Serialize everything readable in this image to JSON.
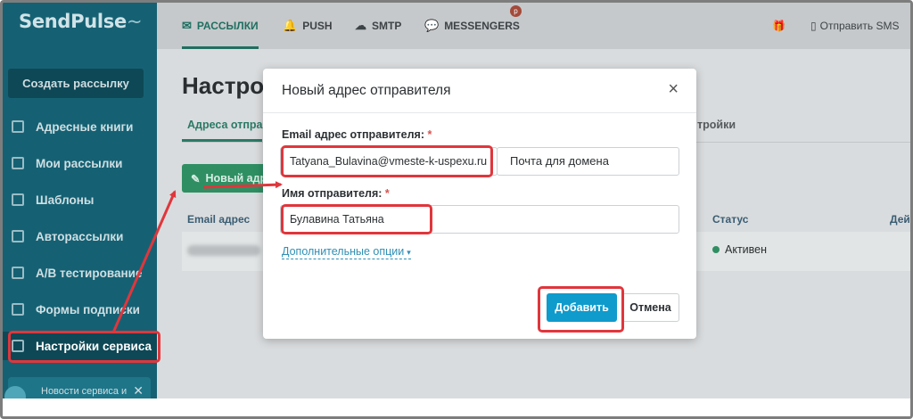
{
  "sidebar": {
    "logo_text": "SendPulse",
    "logo_pulse": "~",
    "create_label": "Создать рассылку",
    "items": [
      {
        "label": "Адресные книги",
        "icon": "address-book-icon"
      },
      {
        "label": "Мои рассылки",
        "icon": "campaigns-icon"
      },
      {
        "label": "Шаблоны",
        "icon": "templates-icon"
      },
      {
        "label": "Авторассылки",
        "icon": "automation-icon"
      },
      {
        "label": "A/B тестирование",
        "icon": "ab-test-icon"
      },
      {
        "label": "Формы подписки",
        "icon": "forms-icon"
      },
      {
        "label": "Настройки сервиса",
        "icon": "settings-icon"
      }
    ],
    "news_text": "Новости сервиса и",
    "news_close": "✕"
  },
  "topbar": {
    "tabs": [
      {
        "label": "РАССЫЛКИ",
        "icon": "mail-icon",
        "glyph": "✉"
      },
      {
        "label": "PUSH",
        "icon": "bell-icon",
        "glyph": "🔔"
      },
      {
        "label": "SMTP",
        "icon": "cloud-icon",
        "glyph": "☁"
      },
      {
        "label": "MESSENGERS",
        "icon": "chat-icon",
        "glyph": "💬"
      }
    ],
    "messengers_badge": "p",
    "gift_glyph": "🎁",
    "sms_label": "Отправить SMS",
    "sms_glyph": "▯"
  },
  "page": {
    "title": "Настрой",
    "subtab_active": "Адреса отправ",
    "subtab_right": "тройки",
    "new_button": "Новый адр",
    "col_email": "Email адрес",
    "col_status": "Статус",
    "col_actions": "Дей",
    "status_value": "Активен"
  },
  "modal": {
    "title": "Новый адрес отправителя",
    "close": "×",
    "email_label": "Email адрес отправителя:",
    "email_value": "Tatyana_Bulavina@vmeste-k-uspexu.ru",
    "domain_placeholder": "Почта для домена",
    "name_label": "Имя отправителя:",
    "name_value": "Булавина Татьяна",
    "required_mark": "*",
    "more_options": "Дополнительные опции",
    "more_caret": "▾",
    "add_button": "Добавить",
    "cancel_button": "Отмена"
  },
  "colors": {
    "sidebar_bg": "#156173",
    "accent_green": "#2f8f63",
    "add_button_blue": "#0f9bcc",
    "annotation_red": "#e0363c"
  }
}
